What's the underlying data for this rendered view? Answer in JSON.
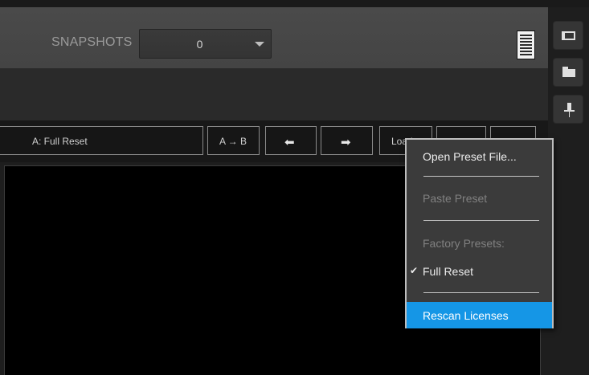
{
  "header": {
    "snapshots_label": "SNAPSHOTS",
    "snapshots_value": "0"
  },
  "toolbar": {
    "preset_name": "A: Full Reset",
    "ab_label": "A → B",
    "prev_icon": "left-arrow",
    "next_icon": "right-arrow",
    "load_label": "Load"
  },
  "sidebar": {
    "icons": [
      "window-icon",
      "folder-icon",
      "pin-icon"
    ]
  },
  "menu": {
    "open_preset": "Open Preset File...",
    "paste_preset": "Paste Preset",
    "factory_presets": "Factory Presets:",
    "full_reset": "Full Reset",
    "full_reset_checked": true,
    "rescan_licenses": "Rescan Licenses",
    "highlight_color": "#1596e6"
  }
}
